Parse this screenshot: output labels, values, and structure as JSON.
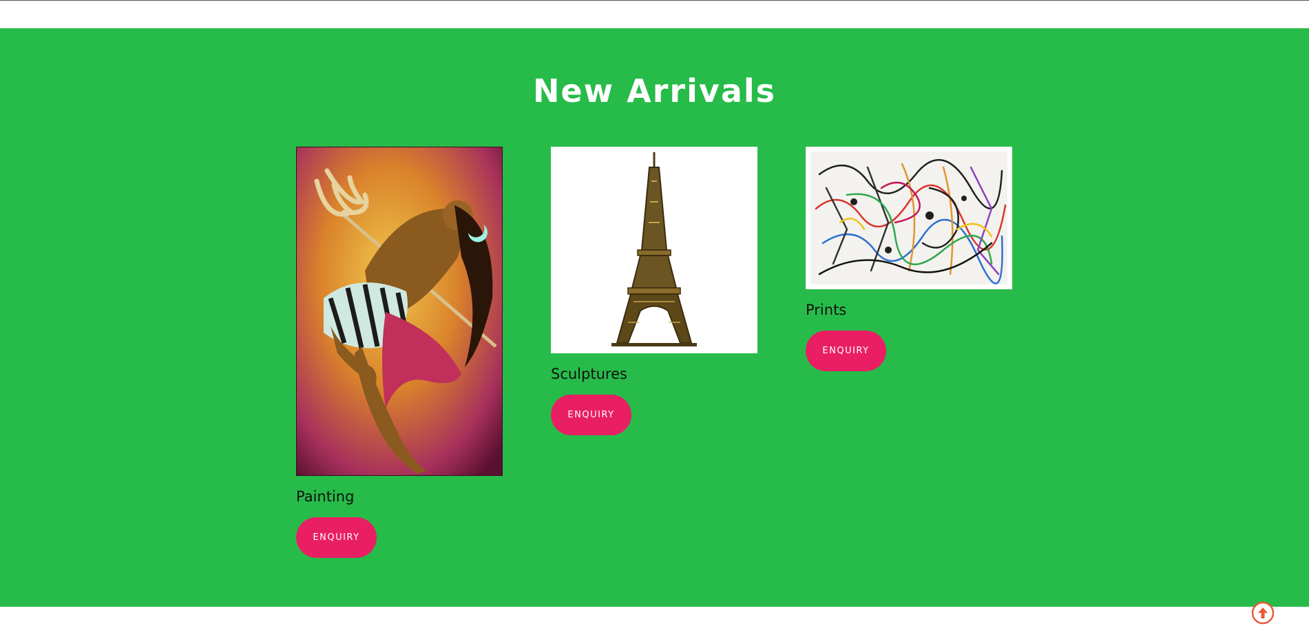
{
  "section": {
    "title": "New Arrivals"
  },
  "products": [
    {
      "label": "Painting",
      "button_label": "ENQUIRY",
      "image_icon": "painting-image"
    },
    {
      "label": "Sculptures",
      "button_label": "ENQUIRY",
      "image_icon": "eiffel-tower-image"
    },
    {
      "label": "Prints",
      "button_label": "ENQUIRY",
      "image_icon": "abstract-print-image"
    }
  ],
  "colors": {
    "section_background": "#27bb4a",
    "button_background": "#ea1e63",
    "scroll_top_accent": "#e85a3a"
  },
  "scroll_top": {
    "icon": "arrow-up-circle-icon"
  }
}
